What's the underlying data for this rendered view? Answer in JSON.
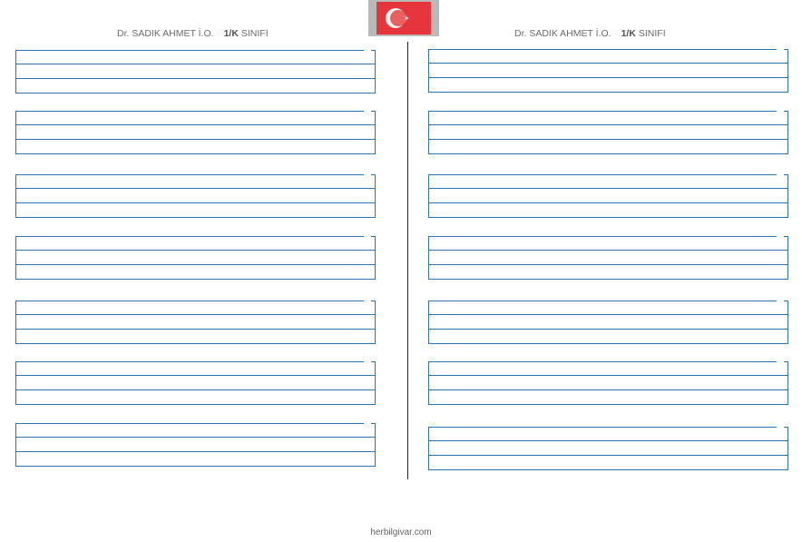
{
  "page": {
    "header_left": {
      "school": "Dr. SADIK AHMET İ.O.",
      "class_bold": "1/K",
      "class_rest": " SINIFI"
    },
    "header_right": {
      "school": "Dr. SADIK AHMET İ.O.",
      "class_bold": "1/K",
      "class_rest": " SINIFI"
    },
    "footer": "herbilgivar.com",
    "line_color": "#2e75b6",
    "flag_color": "#e30a17",
    "writing_blocks_per_column": 7
  }
}
